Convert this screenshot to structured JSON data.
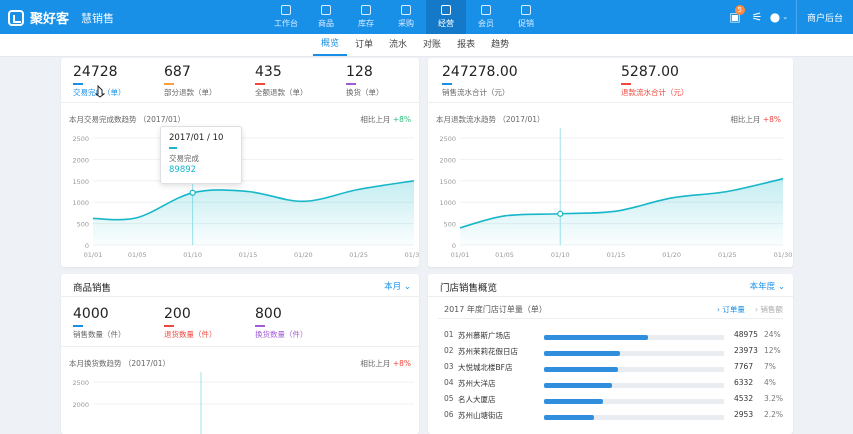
{
  "app": {
    "brand": "聚好客",
    "sub": "慧销售",
    "colors": {
      "primary": "#1890e8",
      "teal": "#16b7c9",
      "green": "#2ebf7a",
      "red": "#f0483e"
    }
  },
  "nav": [
    {
      "label": "工作台",
      "icon": "desk-icon"
    },
    {
      "label": "商品",
      "icon": "goods-icon"
    },
    {
      "label": "库存",
      "icon": "warehouse-icon"
    },
    {
      "label": "采购",
      "icon": "cart-icon"
    },
    {
      "label": "经营",
      "icon": "operate-icon",
      "active": true
    },
    {
      "label": "会员",
      "icon": "crown-icon"
    },
    {
      "label": "促销",
      "icon": "promo-icon"
    }
  ],
  "header": {
    "badge": "5",
    "merchant": "商户后台"
  },
  "subnav": [
    {
      "label": "概览",
      "active": true
    },
    {
      "label": "订单"
    },
    {
      "label": "流水"
    },
    {
      "label": "对账"
    },
    {
      "label": "报表"
    },
    {
      "label": "趋势"
    }
  ],
  "panel1": {
    "stats": [
      {
        "value": "24728",
        "label": "交易完成（单）",
        "color": "#1890e8"
      },
      {
        "value": "687",
        "label": "部分退款（单）",
        "color": "#ff9f40"
      },
      {
        "value": "435",
        "label": "全额退款（单）",
        "color": "#f0483e"
      },
      {
        "value": "128",
        "label": "换货（单）",
        "color": "#a05bd6"
      }
    ],
    "chart_title": "本月交易完成数趋势 （2017/01）",
    "compare_label": "相比上月",
    "compare_value": "+8%",
    "tooltip": {
      "date": "2017/01 / 10",
      "label": "交易完成",
      "value": "89892"
    }
  },
  "panel2": {
    "stats": [
      {
        "value": "247278.00",
        "label": "销售流水合计（元）",
        "color": "#1890e8"
      },
      {
        "value": "5287.00",
        "label": "退款流水合计（元）",
        "color": "#f0483e"
      }
    ],
    "chart_title": "本月退款流水趋势 （2017/01）",
    "compare_label": "相比上月",
    "compare_value": "+8%"
  },
  "panel3": {
    "title": "商品销售",
    "dropdown": "本月",
    "stats": [
      {
        "value": "4000",
        "label": "销售数量（件）",
        "color": "#1890e8"
      },
      {
        "value": "200",
        "label": "退货数量（件）",
        "color": "#f0483e"
      },
      {
        "value": "800",
        "label": "换货数量（件）",
        "color": "#a05bd6"
      }
    ],
    "chart_title": "本月换货数趋势 （2017/01）",
    "compare_label": "相比上月",
    "compare_value": "+8%"
  },
  "panel4": {
    "title": "门店销售概览",
    "dropdown": "本年度",
    "subtitle": "2017 年度门店订单量（单）",
    "toggle_active": "订单量",
    "toggle_other": "销售额",
    "rows": [
      {
        "rank": "01",
        "name": "苏州慕斯广场店",
        "value": "48975",
        "pct": "24%",
        "ratio": 0.58
      },
      {
        "rank": "02",
        "name": "苏州茉莉花假日店",
        "value": "23973",
        "pct": "12%",
        "ratio": 0.42
      },
      {
        "rank": "03",
        "name": "大悦城北楼BF店",
        "value": "7767",
        "pct": "7%",
        "ratio": 0.41
      },
      {
        "rank": "04",
        "name": "苏州大洋店",
        "value": "6332",
        "pct": "4%",
        "ratio": 0.38
      },
      {
        "rank": "05",
        "name": "名人大厦店",
        "value": "4532",
        "pct": "3.2%",
        "ratio": 0.33
      },
      {
        "rank": "06",
        "name": "苏州山塘街店",
        "value": "2953",
        "pct": "2.2%",
        "ratio": 0.28
      }
    ]
  },
  "chart_data": [
    {
      "type": "area",
      "title": "本月交易完成数趋势 （2017/01）",
      "x_ticks": [
        "01/01",
        "01/05",
        "01/10",
        "01/15",
        "01/20",
        "01/25",
        "01/30"
      ],
      "x": [
        1,
        5,
        10,
        15,
        20,
        25,
        30
      ],
      "ylim": [
        0,
        2500
      ],
      "y_ticks": [
        "2500",
        "2000",
        "1500",
        "1000",
        "500",
        "0"
      ],
      "series": [
        {
          "x": [
            1,
            5,
            10,
            15,
            20,
            25,
            30
          ],
          "values": [
            620,
            640,
            1220,
            1250,
            1020,
            1300,
            1500
          ]
        }
      ],
      "highlight_x": 10
    },
    {
      "type": "area",
      "title": "本月退款流水趋势 （2017/01）",
      "x_ticks": [
        "01/01",
        "01/05",
        "01/10",
        "01/15",
        "01/20",
        "01/25",
        "01/30"
      ],
      "x": [
        1,
        5,
        10,
        15,
        20,
        25,
        30
      ],
      "ylim": [
        0,
        2500
      ],
      "y_ticks": [
        "2500",
        "2000",
        "1500",
        "1000",
        "500",
        "0"
      ],
      "series": [
        {
          "x": [
            1,
            5,
            10,
            15,
            20,
            25,
            30
          ],
          "values": [
            400,
            680,
            730,
            790,
            1100,
            1250,
            1550
          ]
        }
      ],
      "highlight_x": 10
    }
  ]
}
